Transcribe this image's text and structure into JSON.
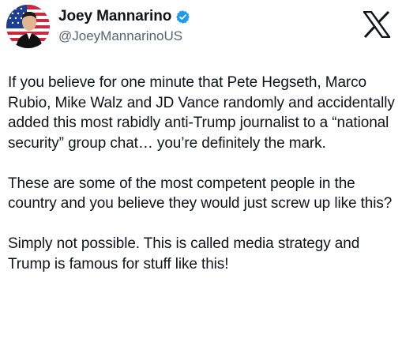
{
  "author": {
    "name": "Joey Mannarino",
    "handle": "@JoeyMannarinoUS"
  },
  "tweet": {
    "paragraphs": [
      "If you believe for one minute that Pete Hegseth, Marco Rubio, Mike Walz and JD Vance randomly and accidentally added this most rabidly anti-Trump journalist to a “national security” group chat… you’re definitely the mark.",
      "These are some of the most competent people in the country and you believe they would just screw up like this?",
      "Simply not possible. This is called media strategy and Trump is famous for stuff like this!"
    ]
  },
  "colors": {
    "verified_badge": "#1d9bf0",
    "handle_gray": "#536471"
  },
  "icons": {
    "verified": "verified-badge-icon",
    "platform": "x-logo-icon"
  }
}
